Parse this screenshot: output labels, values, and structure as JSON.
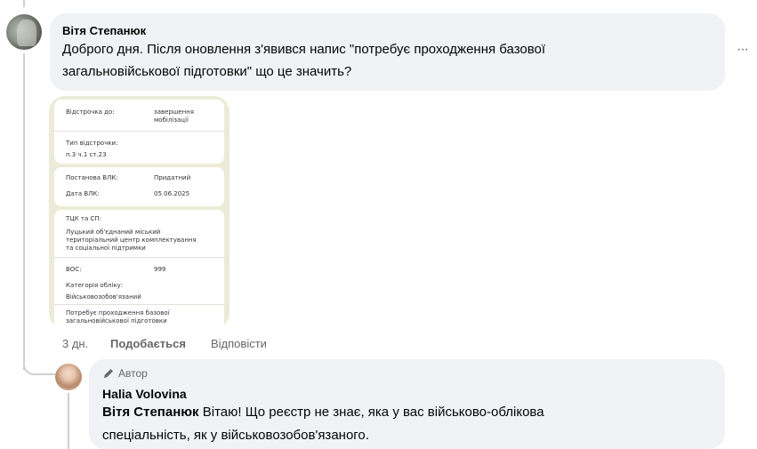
{
  "comment": {
    "author": "Вітя Степанюк",
    "text_line1": "Доброго дня. Після оновлення з'явився напис \"потребує проходження базової",
    "text_line2": "загальновійськової підготовки\" що це значить?",
    "more_icon": "ellipsis-icon",
    "more_label": "···",
    "time": "3 дн.",
    "like_label": "Подобається",
    "reply_label": "Відповісти"
  },
  "attachment": {
    "deferral_label": "Відстрочка до:",
    "deferral_value_1": "завершення",
    "deferral_value_2": "мобілізації",
    "type_label": "Тип відстрочки:",
    "type_value": "п.3 ч.1 ст.23",
    "vlk_label": "Постанова ВЛК:",
    "vlk_value": "Придатний",
    "vlk_date_label": "Дата ВЛК:",
    "vlk_date_value": "05.06.2025",
    "tck_label": "ТЦК та СП:",
    "tck_value_1": "Луцький об'єднаний міський",
    "tck_value_2": "територіальний центр комплектування",
    "tck_value_3": "та соціальної підтримки",
    "vos_label": "ВОС:",
    "vos_value": "999",
    "category_label": "Категорія обліку:",
    "category_value": "Військовозобов'язаний",
    "needs_1": "Потребує проходження базової",
    "needs_2": "загальновійськової підготовки"
  },
  "reply": {
    "badge_icon": "pencil-icon",
    "badge_label": "Автор",
    "author": "Halia Volovina",
    "mention": "Вітя Степанюк",
    "text_line1_rest": " Вітаю! Що реєстр не знає, яка у вас військово-облікова",
    "text_line2": "спеціальність, як у військовозобов'язаного."
  },
  "colors": {
    "bubble_bg": "#f0f2f5",
    "meta_text": "#65676b",
    "thread_line": "#ccd0d5"
  }
}
